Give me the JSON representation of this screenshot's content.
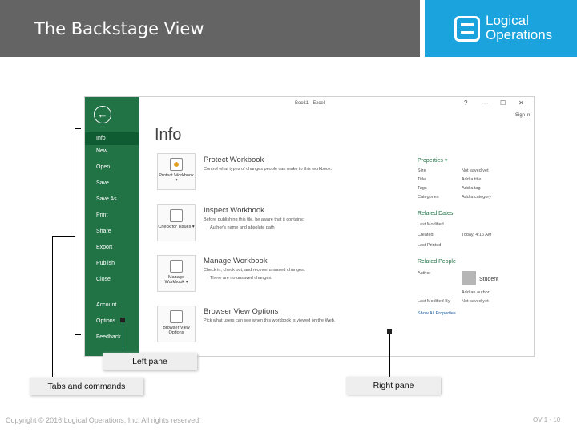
{
  "slide": {
    "title": "The Backstage View",
    "logo": "Logical Operations",
    "footer": "Copyright © 2016 Logical Operations, Inc. All rights reserved.",
    "page_number": "OV 1 - 10"
  },
  "excel": {
    "window_title": "Book1 - Excel",
    "controls": [
      "?",
      "—",
      "☐",
      "✕"
    ],
    "sign_in": "Sign in",
    "back_icon": "back-arrow-icon",
    "nav": [
      {
        "label": "Info",
        "active": true
      },
      {
        "label": "New"
      },
      {
        "label": "Open"
      },
      {
        "label": "Save"
      },
      {
        "label": "Save As"
      },
      {
        "label": "Print"
      },
      {
        "label": "Share"
      },
      {
        "label": "Export"
      },
      {
        "label": "Publish"
      },
      {
        "label": "Close"
      },
      {
        "label": "Account"
      },
      {
        "label": "Options"
      },
      {
        "label": "Feedback"
      }
    ],
    "info_title": "Info",
    "sections": [
      {
        "button": "Protect Workbook ▾",
        "title": "Protect Workbook",
        "desc": "Control what types of changes people can make to this workbook.",
        "icon": "lock-icon"
      },
      {
        "button": "Check for Issues ▾",
        "title": "Inspect Workbook",
        "desc": "Before publishing this file, be aware that it contains:",
        "bullet": "Author's name and absolute path",
        "icon": "inspect-icon"
      },
      {
        "button": "Manage Workbook ▾",
        "title": "Manage Workbook",
        "desc": "Check in, check out, and recover unsaved changes.",
        "bullet": "There are no unsaved changes.",
        "icon": "manage-icon"
      },
      {
        "button": "Browser View Options",
        "title": "Browser View Options",
        "desc": "Pick what users can see when this workbook is viewed on the Web.",
        "icon": "browser-icon"
      }
    ],
    "properties": {
      "heading": "Properties ▾",
      "rows": [
        {
          "k": "Size",
          "v": "Not saved yet"
        },
        {
          "k": "Title",
          "v": "Add a title"
        },
        {
          "k": "Tags",
          "v": "Add a tag"
        },
        {
          "k": "Categories",
          "v": "Add a category"
        }
      ]
    },
    "related_dates": {
      "heading": "Related Dates",
      "rows": [
        {
          "k": "Last Modified",
          "v": ""
        },
        {
          "k": "Created",
          "v": "Today, 4:16 AM"
        },
        {
          "k": "Last Printed",
          "v": ""
        }
      ]
    },
    "related_people": {
      "heading": "Related People",
      "author_label": "Author",
      "author_name": "Student",
      "add_author": "Add an author",
      "last_modified_by": "Last Modified By",
      "last_modified_value": "Not saved yet",
      "show_all": "Show All Properties"
    }
  },
  "callouts": {
    "left_pane": "Left pane",
    "tabs_commands": "Tabs and commands",
    "right_pane": "Right pane"
  }
}
